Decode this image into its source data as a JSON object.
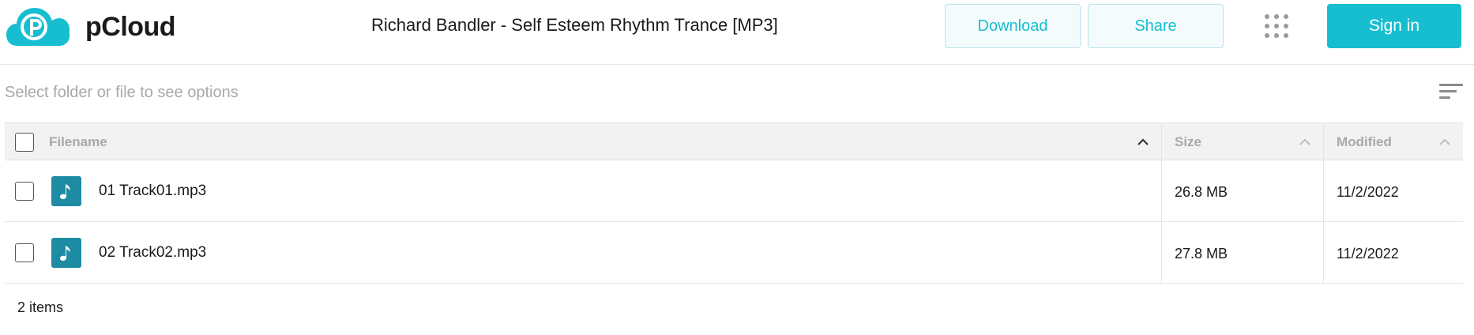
{
  "header": {
    "brand": "pCloud",
    "title": "Richard Bandler - Self Esteem Rhythm Trance [MP3]",
    "download_label": "Download",
    "share_label": "Share",
    "signin_label": "Sign in",
    "apps_icon": "grid-dots-icon"
  },
  "toolbar": {
    "hint": "Select folder or file to see options",
    "sort_icon": "sort-lines-icon"
  },
  "table": {
    "columns": {
      "filename": "Filename",
      "size": "Size",
      "modified": "Modified"
    },
    "rows": [
      {
        "name": "01 Track01.mp3",
        "size": "26.8 MB",
        "modified": "11/2/2022",
        "icon": "music-note-icon"
      },
      {
        "name": "02 Track02.mp3",
        "size": "27.8 MB",
        "modified": "11/2/2022",
        "icon": "music-note-icon"
      }
    ]
  },
  "footer": {
    "count": "2 items"
  },
  "colors": {
    "accent": "#17bed0",
    "file_icon_bg": "#1d8ba2",
    "header_row_bg": "#f2f2f2"
  }
}
